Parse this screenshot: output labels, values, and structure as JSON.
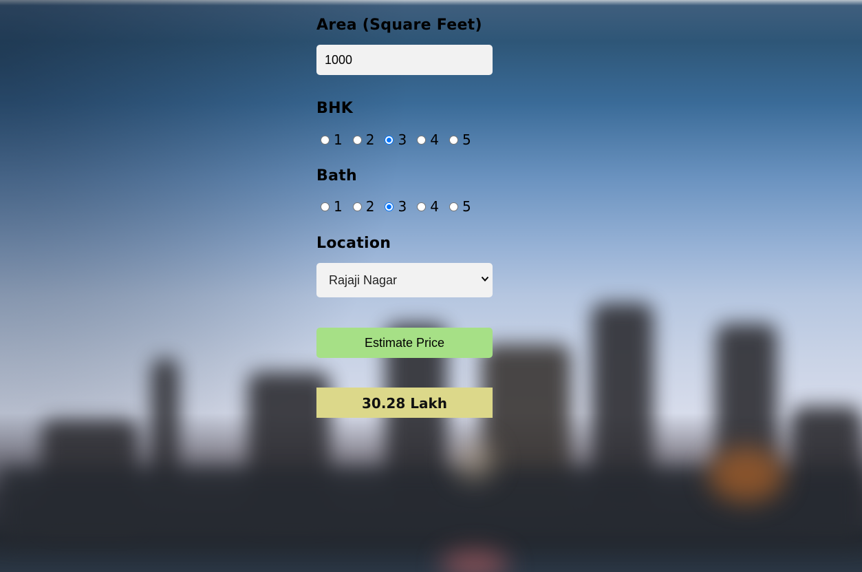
{
  "form": {
    "area": {
      "label": "Area (Square Feet)",
      "value": "1000"
    },
    "bhk": {
      "label": "BHK",
      "options": [
        "1",
        "2",
        "3",
        "4",
        "5"
      ],
      "selected": "3"
    },
    "bath": {
      "label": "Bath",
      "options": [
        "1",
        "2",
        "3",
        "4",
        "5"
      ],
      "selected": "3"
    },
    "location": {
      "label": "Location",
      "selected": "Rajaji Nagar"
    },
    "estimate_button": "Estimate Price",
    "result": "30.28 Lakh"
  },
  "colors": {
    "button": "#a6e086",
    "result_bg": "#dcd88a",
    "input_bg": "#f2f2f2",
    "radio_checked": "#0075ff"
  }
}
